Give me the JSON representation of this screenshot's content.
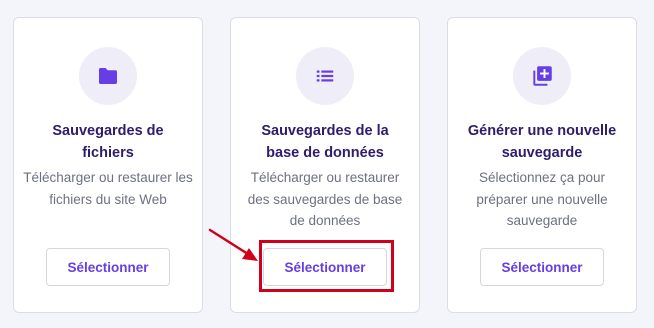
{
  "cards": [
    {
      "icon": "folder-icon",
      "title_line1": "Sauvegardes de",
      "title_line2": "fichiers",
      "desc_line1": "Télécharger ou restaurer les",
      "desc_line2": "fichiers du site Web",
      "desc_line3": "",
      "button_label": "Sélectionner"
    },
    {
      "icon": "list-icon",
      "title_line1": "Sauvegardes de la",
      "title_line2": "base de données",
      "desc_line1": "Télécharger ou restaurer",
      "desc_line2": "des sauvegardes de base",
      "desc_line3": "de données",
      "button_label": "Sélectionner"
    },
    {
      "icon": "add-library-icon",
      "title_line1": "Générer une nouvelle",
      "title_line2": "sauvegarde",
      "desc_line1": "Sélectionnez ça pour",
      "desc_line2": "préparer une nouvelle",
      "desc_line3": "sauvegarde",
      "button_label": "Sélectionner"
    }
  ],
  "colors": {
    "accent": "#673de6",
    "title": "#2f1c6a",
    "body_text": "#6d7081",
    "icon_bg": "#efeef8",
    "annotation": "#d0021b"
  }
}
